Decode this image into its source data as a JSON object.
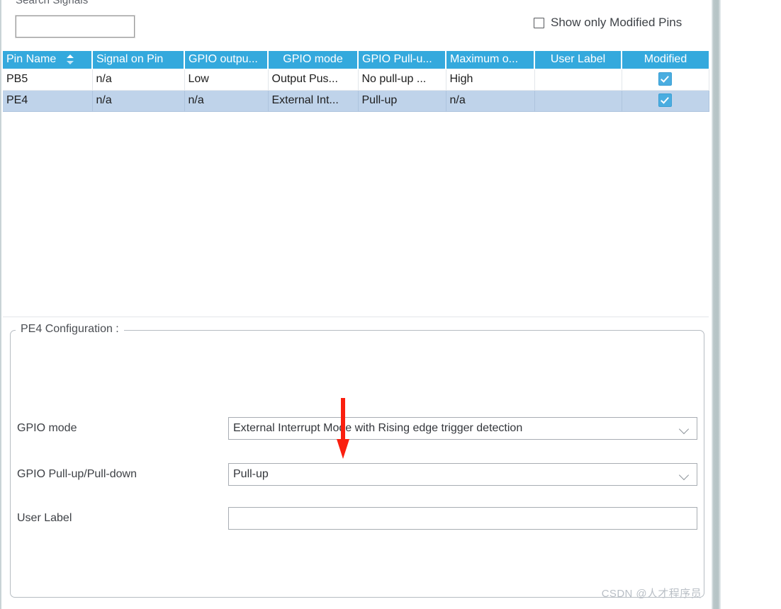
{
  "search": {
    "label": "Search Signals",
    "value": "",
    "placeholder": ""
  },
  "filter": {
    "show_only_modified_label": "Show only Modified Pins",
    "show_only_modified_checked": false
  },
  "table": {
    "sort_column": "Pin Name",
    "sort_direction": "asc",
    "columns": [
      "Pin Name",
      "Signal on Pin",
      "GPIO outpu...",
      "GPIO mode",
      "GPIO Pull-u...",
      "Maximum o...",
      "User Label",
      "Modified"
    ],
    "rows": [
      {
        "pin_name": "PB5",
        "signal_on_pin": "n/a",
        "gpio_output": "Low",
        "gpio_mode": "Output Pus...",
        "gpio_pull": "No pull-up ...",
        "maximum_output": "High",
        "user_label": "",
        "modified": true,
        "selected": false
      },
      {
        "pin_name": "PE4",
        "signal_on_pin": "n/a",
        "gpio_output": "n/a",
        "gpio_mode": "External Int...",
        "gpio_pull": "Pull-up",
        "maximum_output": "n/a",
        "user_label": "",
        "modified": true,
        "selected": true
      }
    ]
  },
  "config": {
    "group_title": "PE4 Configuration :",
    "fields": {
      "gpio_mode": {
        "label": "GPIO mode",
        "value": "External Interrupt Mode with Rising edge trigger detection"
      },
      "gpio_pull": {
        "label": "GPIO Pull-up/Pull-down",
        "value": "Pull-up"
      },
      "user_label": {
        "label": "User Label",
        "value": ""
      }
    }
  },
  "annotation": {
    "arrow_color": "#fa1f0f",
    "points_to": "gpio_mode"
  },
  "watermark": {
    "text": "CSDN @人才程序员"
  },
  "colors": {
    "header_blue": "#34a9dd",
    "selected_row": "#bfd3ea",
    "checkbox_blue": "#4aade0"
  }
}
